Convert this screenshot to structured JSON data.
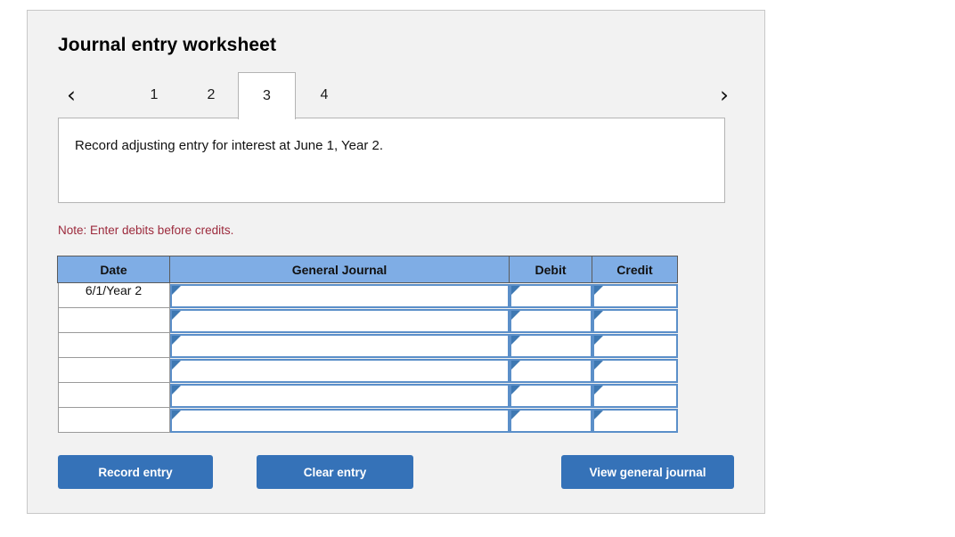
{
  "panel": {
    "title": "Journal entry worksheet"
  },
  "tabs": {
    "prev_icon": "chevron-left-icon",
    "next_icon": "chevron-right-icon",
    "prev_glyph": "‹",
    "next_glyph": "›",
    "items": [
      {
        "label": "1",
        "active": false
      },
      {
        "label": "2",
        "active": false
      },
      {
        "label": "3",
        "active": true
      },
      {
        "label": "4",
        "active": false
      }
    ]
  },
  "description": {
    "text": "Record adjusting entry for interest at June 1, Year 2."
  },
  "note": {
    "text": "Note: Enter debits before credits."
  },
  "table": {
    "headers": {
      "date": "Date",
      "general_journal": "General Journal",
      "debit": "Debit",
      "credit": "Credit"
    },
    "rows": [
      {
        "date": "6/1/Year 2",
        "general_journal": "",
        "debit": "",
        "credit": ""
      },
      {
        "date": "",
        "general_journal": "",
        "debit": "",
        "credit": ""
      },
      {
        "date": "",
        "general_journal": "",
        "debit": "",
        "credit": ""
      },
      {
        "date": "",
        "general_journal": "",
        "debit": "",
        "credit": ""
      },
      {
        "date": "",
        "general_journal": "",
        "debit": "",
        "credit": ""
      },
      {
        "date": "",
        "general_journal": "",
        "debit": "",
        "credit": ""
      }
    ]
  },
  "buttons": {
    "record": "Record entry",
    "clear": "Clear entry",
    "view": "View general journal"
  },
  "colors": {
    "header_blue": "#7fade5",
    "button_blue": "#3572b8",
    "field_border": "#5b8fc9",
    "note_red": "#9c2a3c",
    "panel_bg": "#f2f2f2"
  }
}
